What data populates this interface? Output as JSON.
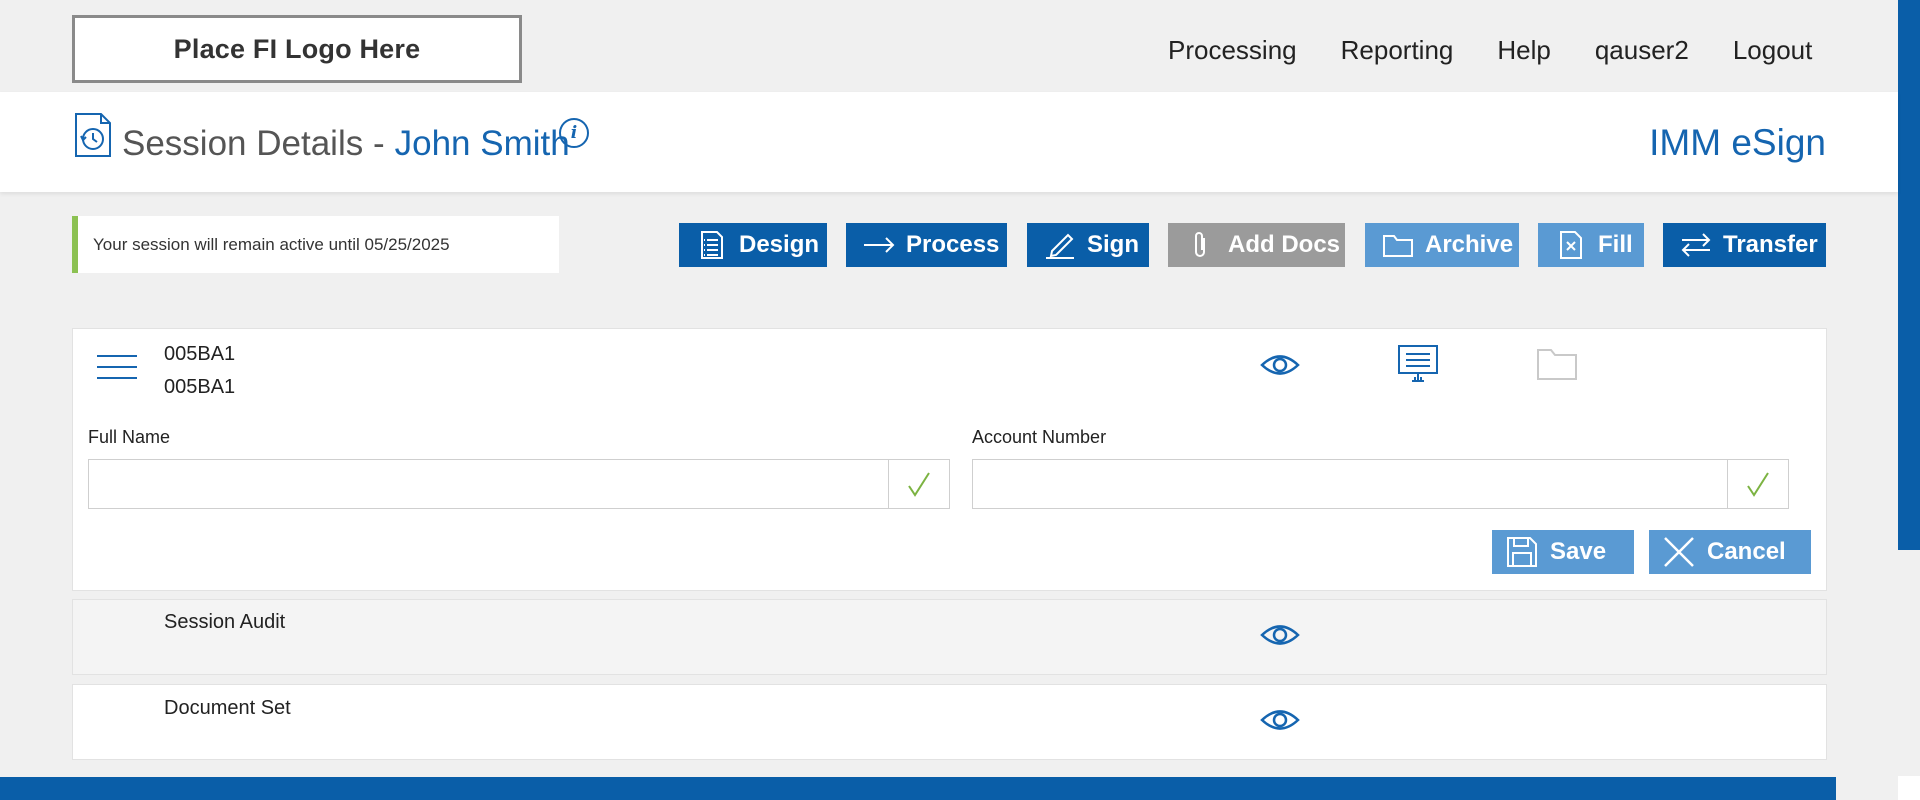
{
  "header": {
    "logo_text": "Place FI Logo Here",
    "nav": [
      "Processing",
      "Reporting",
      "Help",
      "qauser2",
      "Logout"
    ]
  },
  "title": {
    "prefix": "Session Details -",
    "name": "John Smith",
    "info_icon": "i",
    "product": "IMM eSign"
  },
  "notice": "Your session will remain active until 05/25/2025",
  "actions": {
    "design": "Design",
    "process": "Process",
    "sign": "Sign",
    "add_docs": "Add Docs",
    "archive": "Archive",
    "fill": "Fill",
    "transfer": "Transfer"
  },
  "document": {
    "id_line1": "005BA1",
    "id_line2": "005BA1",
    "full_name_label": "Full Name",
    "full_name_value": "",
    "account_label": "Account Number",
    "account_value": "",
    "save": "Save",
    "cancel": "Cancel"
  },
  "rows": {
    "session_audit": "Session Audit",
    "document_set": "Document Set"
  },
  "colors": {
    "primary": "#0a5ea8",
    "link_blue": "#1565b0",
    "light_button": "#5a9ad3",
    "disabled_button": "#9b9b9b",
    "notice_accent": "#8cc152",
    "check_green": "#7cb342"
  }
}
